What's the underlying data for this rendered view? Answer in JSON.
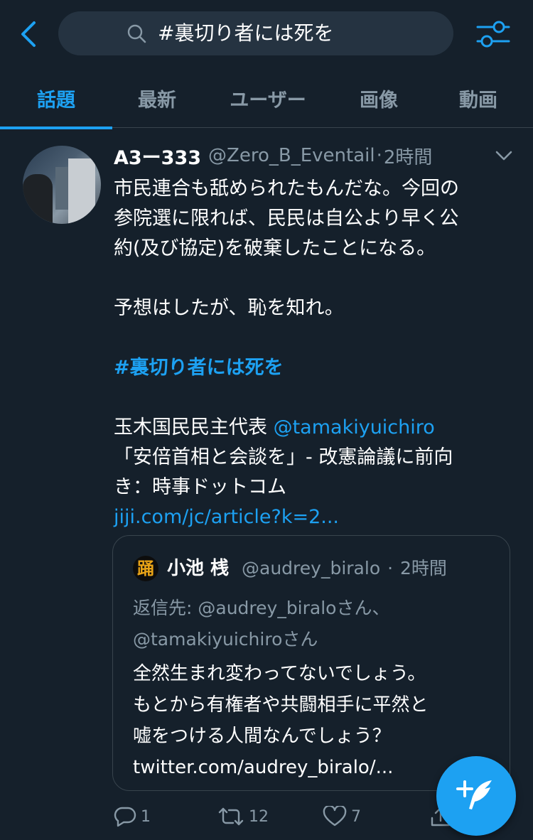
{
  "search": {
    "query": "#裏切り者には死を"
  },
  "tabs": [
    {
      "label": "話題",
      "active": true
    },
    {
      "label": "最新"
    },
    {
      "label": "ユーザー"
    },
    {
      "label": "画像"
    },
    {
      "label": "動画"
    }
  ],
  "tweet": {
    "display_name": "A3ー333",
    "handle": "@Zero_B_Eventail",
    "separator": "·",
    "time": "2時間",
    "lines": [
      "市民連合も舐められたもんだな。今回の",
      "参院選に限れば、民民は自公より早く公",
      "約(及び協定)を破棄したことになる。"
    ],
    "line2": "予想はしたが、恥を知れ。",
    "hashtag": "#裏切り者には死を",
    "news_prefix": "玉木国民民主代表 ",
    "news_mention": "@tamakiyuichiro",
    "news_line2": "「安倍首相と会談を」- 改憲論議に前向",
    "news_line3": "き：時事ドットコム",
    "link": "jiji.com/jc/article?k=2..."
  },
  "quote": {
    "avatar_glyph": "踊",
    "display_name": "小池 桟",
    "handle": "@audrey_biralo",
    "separator": "·",
    "time": "2時間",
    "reply_prefix": "返信先: ",
    "reply_mention1": "@audrey_biraloさん、",
    "reply_mention2": "@tamakiyuichiroさん",
    "text": [
      "全然生まれ変わってないでしょう。",
      "もとから有権者や共闘相手に平然と",
      "嘘をつける人間なんでしょう？",
      "twitter.com/audrey_biralo/..."
    ]
  },
  "actions": {
    "reply_count": "1",
    "retweet_count": "12",
    "like_count": "7"
  },
  "colors": {
    "background": "#15202b",
    "accent": "#1da1f2",
    "muted": "#8899a6",
    "border": "#38444d"
  }
}
